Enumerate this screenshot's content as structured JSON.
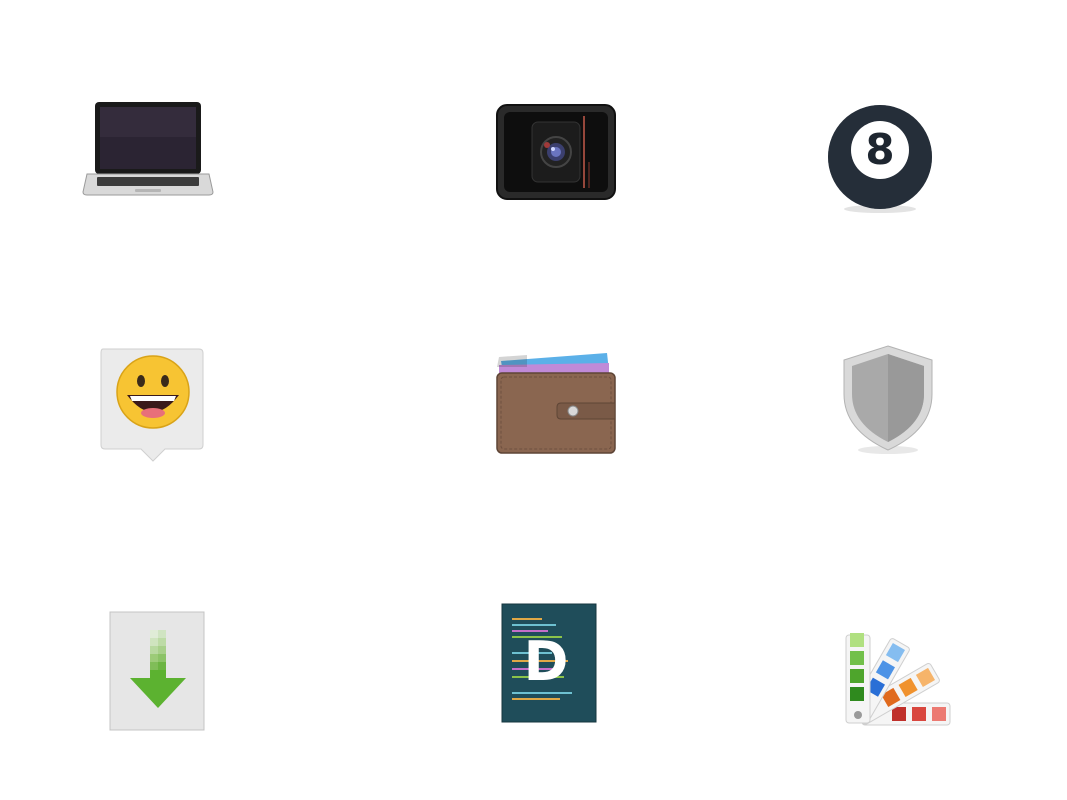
{
  "icons": [
    {
      "name": "laptop-icon"
    },
    {
      "name": "webcam-icon"
    },
    {
      "name": "eight-ball-icon",
      "glyph": "8"
    },
    {
      "name": "smiley-chat-icon"
    },
    {
      "name": "wallet-icon"
    },
    {
      "name": "shield-icon"
    },
    {
      "name": "download-file-icon"
    },
    {
      "name": "code-editor-icon",
      "glyph": "D"
    },
    {
      "name": "color-palette-icon"
    }
  ],
  "colors": {
    "background": "#ffffff",
    "laptop_screen": "#2b2433",
    "eight_ball": "#1e2630",
    "smiley_face": "#f7c433",
    "wallet_leather": "#8a6650",
    "shield_gray": "#a9a9a9",
    "download_arrow": "#5cb230",
    "editor_teal": "#1f4d5a"
  }
}
